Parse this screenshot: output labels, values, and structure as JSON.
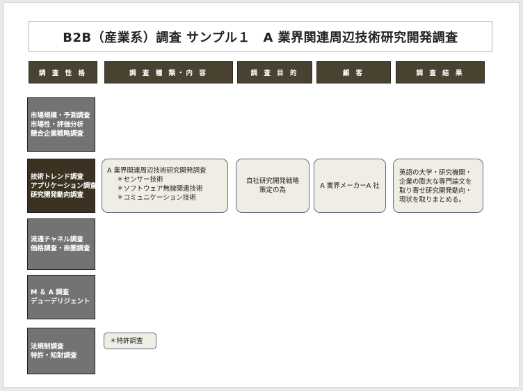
{
  "title": "B2B（産業系）調査 サンプル１　A 業界関連周辺技術研究開発調査",
  "headers": [
    "調 査 性 格",
    "調 査 種 類・内 容",
    "調 査 目 的",
    "顧 客",
    "調 査 結 果"
  ],
  "categories": [
    "市場規模・予測調査\n市場性・評価分析\n競合企業戦略調査",
    "技術トレンド調査\nアプリケーション調査\n研究開発動向調査",
    "流通チャネル調査\n価格調査・商圏調査",
    "M ＆ A 調査\nデューデリジェント",
    "法規制調査\n特許・知財調査"
  ],
  "tech_row": {
    "content_title": "A 業界関連周辺技術研究開発調査",
    "content_items": [
      "＊センサー技術",
      "＊ソフトウェア無線関連技術",
      "＊コミュニケーション技術"
    ],
    "purpose": "自社研究開発戦略\n策定の為",
    "customer": "A 業界メーカーA 社",
    "result": "英語の大学・研究機関・\n企業の膨大な専門論文を\n取り寄せ研究開発動向・\n現状を取りまとめる。"
  },
  "patent_row": {
    "content": "＊特許調査"
  }
}
